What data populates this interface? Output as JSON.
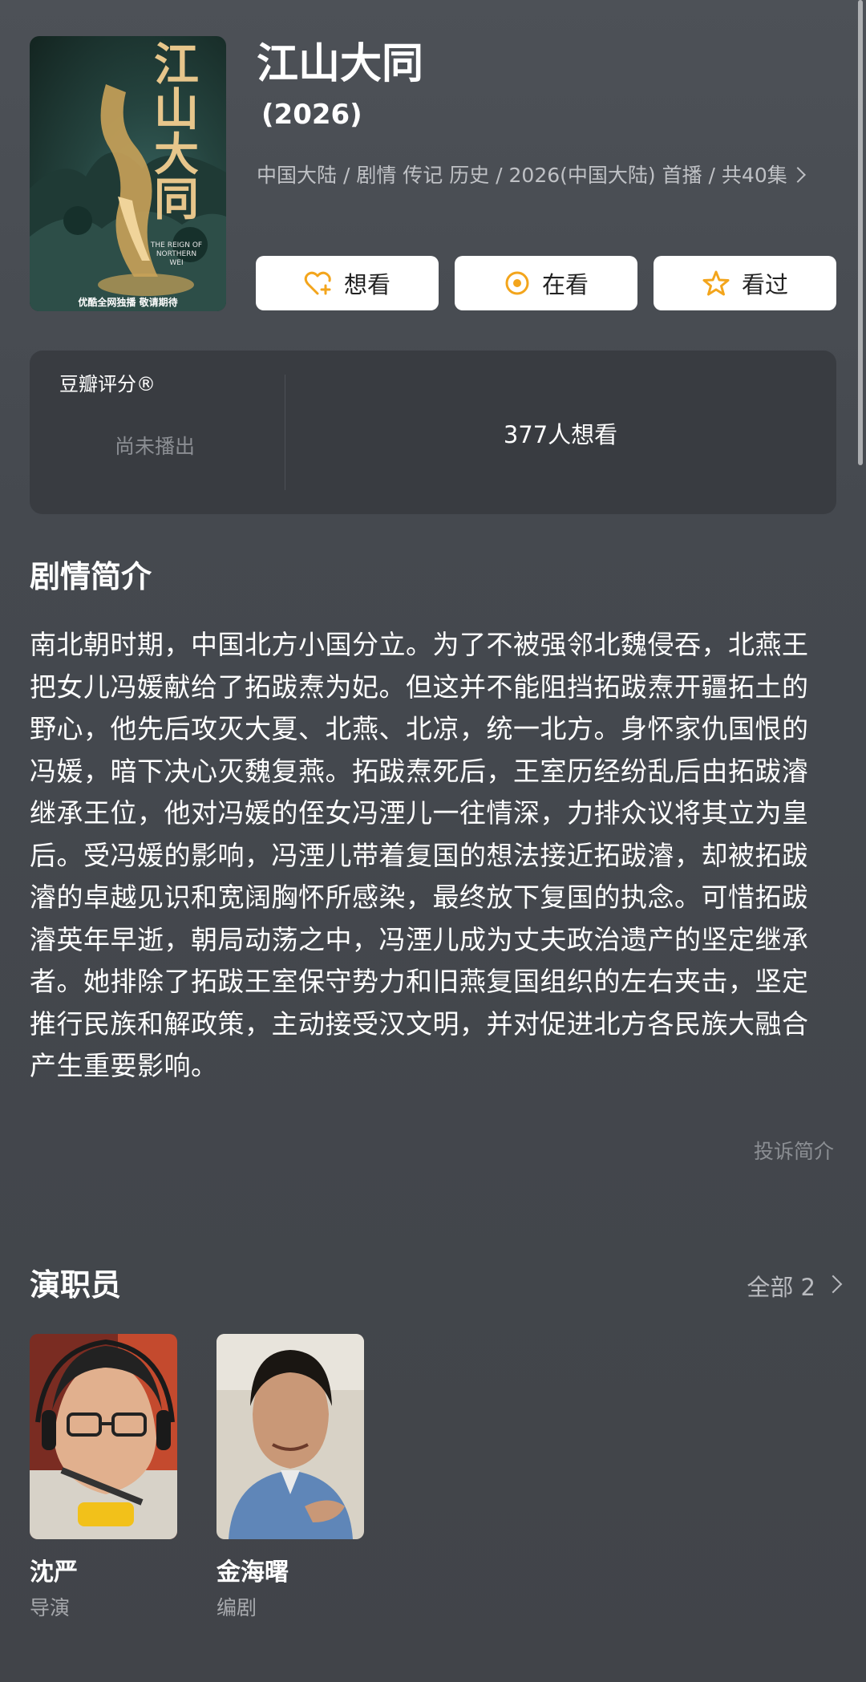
{
  "movie": {
    "title": "江山大同",
    "year": "(2026)",
    "meta": "中国大陆 / 剧情 传记 历史 / 2026(中国大陆) 首播 / 共40集",
    "poster": {
      "title": "江山大同",
      "english": "THE REIGN OF NORTHERN WEI",
      "subtitle": "优酷全网独播 敬请期待"
    }
  },
  "actions": [
    {
      "label": "想看",
      "icon": "heart-plus-icon"
    },
    {
      "label": "在看",
      "icon": "target-icon"
    },
    {
      "label": "看过",
      "icon": "star-icon"
    }
  ],
  "rating": {
    "label": "豆瓣评分®",
    "status": "尚未播出",
    "wish_count": "377人想看"
  },
  "synopsis": {
    "heading": "剧情简介",
    "text": "南北朝时期，中国北方小国分立。为了不被强邻北魏侵吞，北燕王把女儿冯媛献给了拓跋焘为妃。但这并不能阻挡拓跋焘开疆拓土的野心，他先后攻灭大夏、北燕、北凉，统一北方。身怀家仇国恨的冯媛，暗下决心灭魏复燕。拓跋焘死后，王室历经纷乱后由拓跋濬继承王位，他对冯媛的侄女冯湮儿一往情深，力排众议将其立为皇后。受冯媛的影响，冯湮儿带着复国的想法接近拓跋濬，却被拓跋濬的卓越见识和宽阔胸怀所感染，最终放下复国的执念。可惜拓跋濬英年早逝，朝局动荡之中，冯湮儿成为丈夫政治遗产的坚定继承者。她排除了拓跋王室保守势力和旧燕复国组织的左右夹击，坚定推行民族和解政策，主动接受汉文明，并对促进北方各民族大融合产生重要影响。",
    "report": "投诉简介"
  },
  "cast": {
    "heading": "演职员",
    "all_label": "全部 2",
    "members": [
      {
        "name": "沈严",
        "role": "导演"
      },
      {
        "name": "金海曙",
        "role": "编剧"
      }
    ]
  },
  "colors": {
    "accent": "#f3a51c",
    "background": "#45494f",
    "card": "#393c41"
  }
}
